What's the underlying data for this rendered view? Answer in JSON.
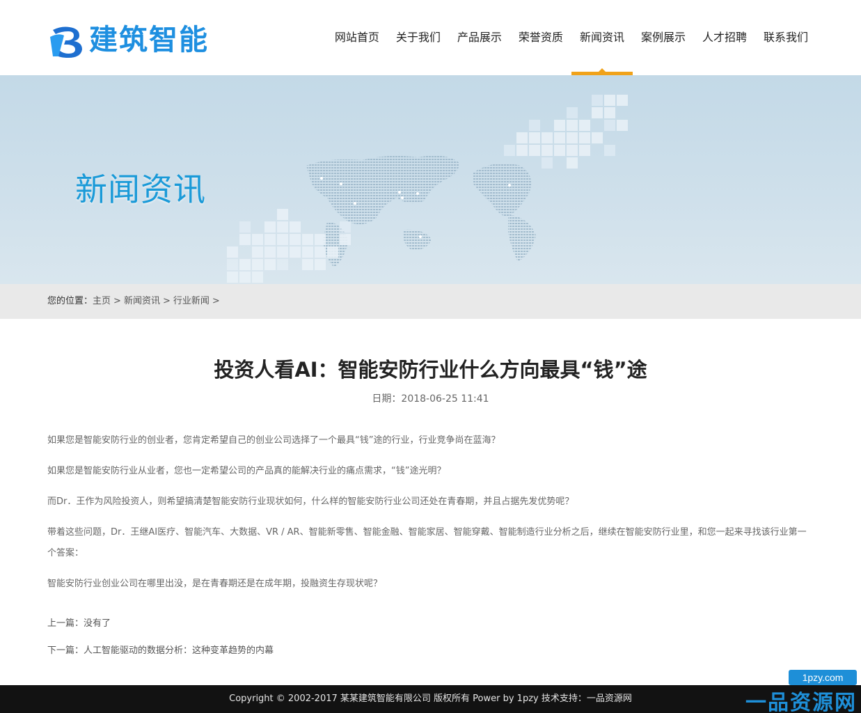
{
  "brand": {
    "name": "建筑智能",
    "primary_color": "#1e8fe0",
    "accent_color": "#f0a21a"
  },
  "nav": {
    "items": [
      {
        "label": "网站首页"
      },
      {
        "label": "关于我们"
      },
      {
        "label": "产品展示"
      },
      {
        "label": "荣誉资质"
      },
      {
        "label": "新闻资讯",
        "active": true
      },
      {
        "label": "案例展示"
      },
      {
        "label": "人才招聘"
      },
      {
        "label": "联系我们"
      }
    ]
  },
  "banner": {
    "title": "新闻资讯"
  },
  "breadcrumb": {
    "label": "您的位置：",
    "items": [
      "主页",
      "新闻资讯",
      "行业新闻"
    ],
    "separator": ">"
  },
  "article": {
    "title": "投资人看AI：智能安防行业什么方向最具“钱”途",
    "date": "日期：2018-06-25 11:41",
    "paragraphs": [
      "如果您是智能安防行业的创业者，您肯定希望自己的创业公司选择了一个最具“钱”途的行业，行业竞争尚在蓝海？",
      "如果您是智能安防行业从业者，您也一定希望公司的产品真的能解决行业的痛点需求，“钱”途光明？",
      "而Dr．王作为风险投资人，则希望搞清楚智能安防行业现状如何，什么样的智能安防行业公司还处在青春期，并且占据先发优势呢？",
      "带着这些问题，Dr．王继AI医疗、智能汽车、大数据、VR / AR、智能新零售、智能金融、智能家居、智能穿戴、智能制造行业分析之后，继续在智能安防行业里，和您一起来寻找该行业第一个答案：",
      "智能安防行业创业公司在哪里出没，是在青春期还是在成年期，投融资生存现状呢？"
    ],
    "prev": "上一篇：没有了",
    "next": "下一篇：人工智能驱动的数据分析：这种变革趋势的内幕"
  },
  "footer": {
    "text": "Copyright © 2002-2017 某某建筑智能有限公司 版权所有 Power by 1pzy   技术支持：一品资源网"
  },
  "watermark": {
    "url": "1pzy.com",
    "name": "一品资源网"
  }
}
